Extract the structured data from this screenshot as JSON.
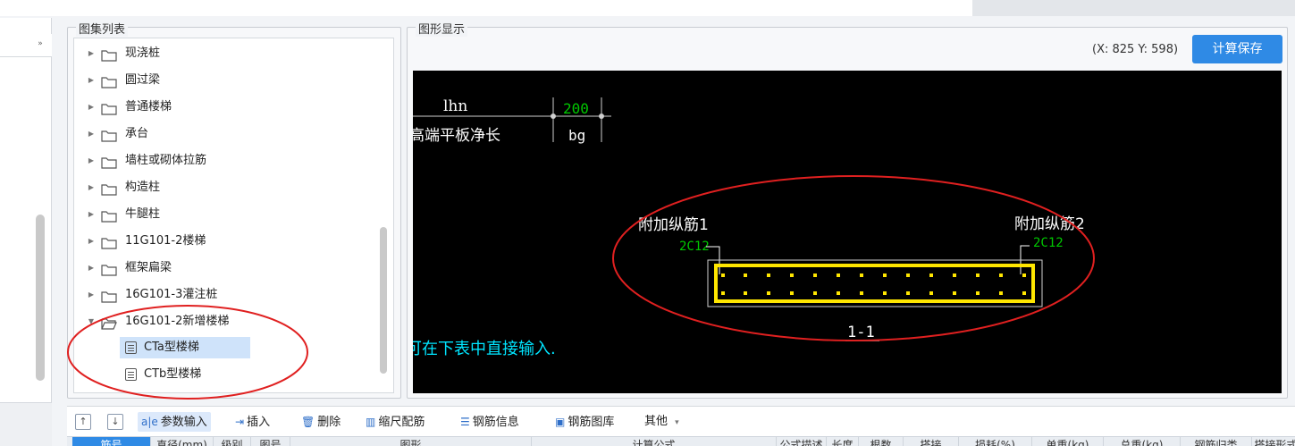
{
  "top": {},
  "left_panel": {
    "collapse_glyph": "»"
  },
  "atlas": {
    "title": "图集列表",
    "items": [
      {
        "label": "现浇桩",
        "expanded": false
      },
      {
        "label": "圆过梁",
        "expanded": false
      },
      {
        "label": "普通楼梯",
        "expanded": false
      },
      {
        "label": "承台",
        "expanded": false
      },
      {
        "label": "墙柱或砌体拉筋",
        "expanded": false
      },
      {
        "label": "构造柱",
        "expanded": false
      },
      {
        "label": "牛腿柱",
        "expanded": false
      },
      {
        "label": "11G101-2楼梯",
        "expanded": false
      },
      {
        "label": "框架扁梁",
        "expanded": false
      },
      {
        "label": "16G101-3灌注桩",
        "expanded": false
      },
      {
        "label": "16G101-2新增楼梯",
        "expanded": true
      }
    ],
    "children": [
      {
        "label": "CTa型楼梯",
        "selected": true
      },
      {
        "label": "CTb型楼梯",
        "selected": false
      }
    ]
  },
  "graphic": {
    "title": "图形显示",
    "coords": "(X: 825 Y: 598)",
    "save_label": "计算保存",
    "drawing": {
      "label_lhn": "lhn",
      "label_length": "高端平板净长",
      "value_200": "200",
      "label_bg": "bg",
      "rebar1": "附加纵筋1",
      "rebar1_spec": "2C12",
      "rebar2": "附加纵筋2",
      "rebar2_spec": "2C12",
      "section": "1-1",
      "hint": "可在下表中直接输入."
    }
  },
  "toolbar": {
    "up_glyph": "↑",
    "down_glyph": "↓",
    "param_input": "参数输入",
    "insert": "插入",
    "delete": "删除",
    "scale_rebar": "缩尺配筋",
    "rebar_info": "钢筋信息",
    "rebar_library": "钢筋图库",
    "other": "其他"
  },
  "table": {
    "columns": [
      "筋号",
      "直径(mm)",
      "级别",
      "图号",
      "图形",
      "计算公式",
      "公式描述",
      "长度",
      "根数",
      "搭接",
      "损耗(%)",
      "单重(kg)",
      "总重(kg)",
      "钢筋归类",
      "搭接形式"
    ]
  },
  "colors": {
    "accent": "#2f8ae5",
    "cad_green": "#00c800",
    "cad_yellow": "#ffe600",
    "cad_cyan": "#00e5ff",
    "annotation_red": "#e02020"
  }
}
